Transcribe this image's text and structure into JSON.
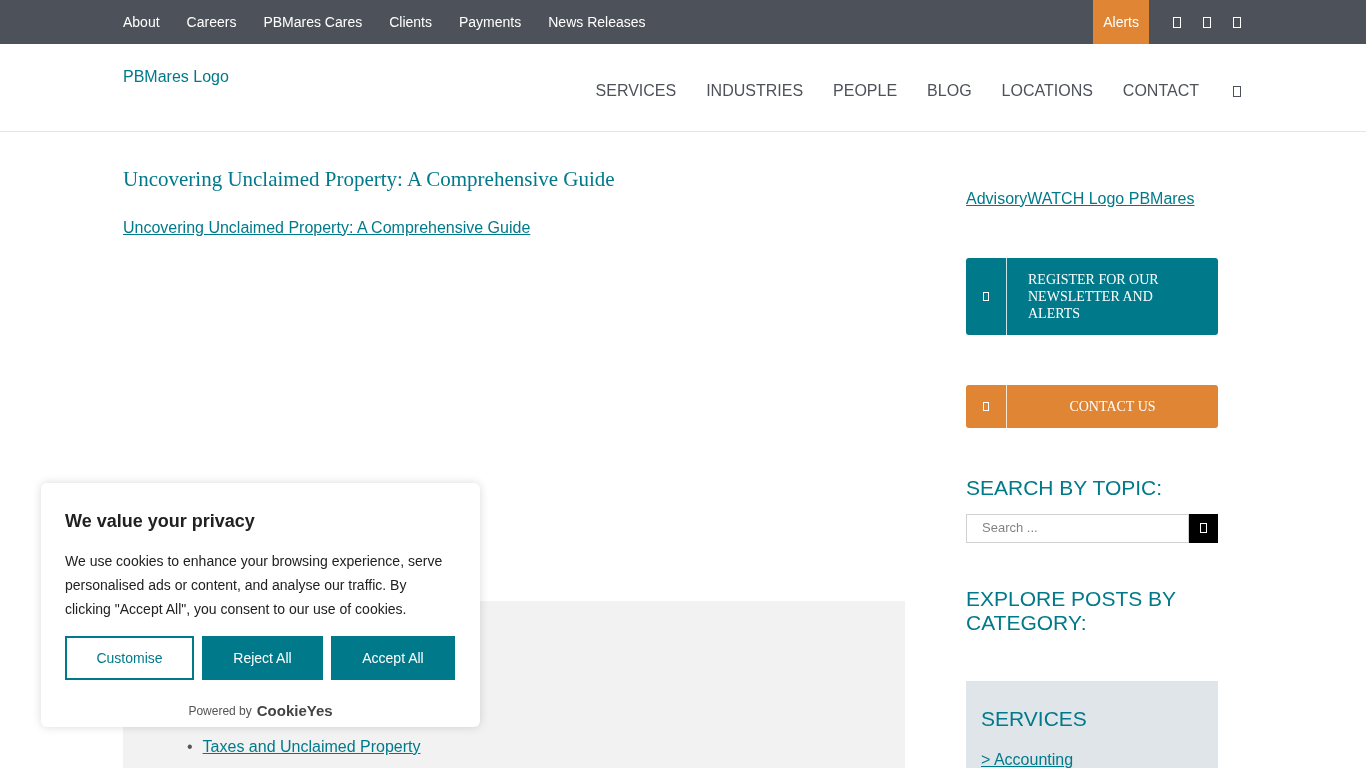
{
  "top_bar": {
    "links": [
      "About",
      "Careers",
      "PBMares Cares",
      "Clients",
      "Payments",
      "News Releases"
    ],
    "alerts": "Alerts"
  },
  "header": {
    "logo_alt": "PBMares Logo",
    "nav": [
      "SERVICES",
      "INDUSTRIES",
      "PEOPLE",
      "BLOG",
      "LOCATIONS",
      "CONTACT"
    ]
  },
  "article": {
    "title": "Uncovering Unclaimed Property: A Comprehensive Guide",
    "image_alt": "Uncovering Unclaimed Property: A Comprehensive Guide",
    "contents": [
      {
        "bullet": "•",
        "text": "Taxes and Unclaimed Property"
      }
    ]
  },
  "sidebar": {
    "logo_alt": "AdvisoryWATCH Logo PBMares",
    "buttons": [
      {
        "label": "REGISTER FOR OUR NEWSLETTER AND ALERTS",
        "color": "#007a8a"
      },
      {
        "label": "CONTACT US",
        "color": "#df8534"
      }
    ],
    "search_heading": "SEARCH BY TOPIC:",
    "search_placeholder": "Search ...",
    "category_heading": "EXPLORE POSTS BY CATEGORY:",
    "category_box": {
      "title": "SERVICES",
      "links": [
        "> Accounting"
      ]
    }
  },
  "cookie_banner": {
    "title": "We value your privacy",
    "text": "We use cookies to enhance your browsing experience, serve personalised ads or content, and analyse our traffic. By clicking \"Accept All\", you consent to our use of cookies.",
    "buttons": [
      {
        "label": "Customise",
        "kind": "outline"
      },
      {
        "label": "Reject All",
        "kind": "filled"
      },
      {
        "label": "Accept All",
        "kind": "filled"
      }
    ],
    "powered_by": "Powered by",
    "brand": "CookieYes"
  }
}
